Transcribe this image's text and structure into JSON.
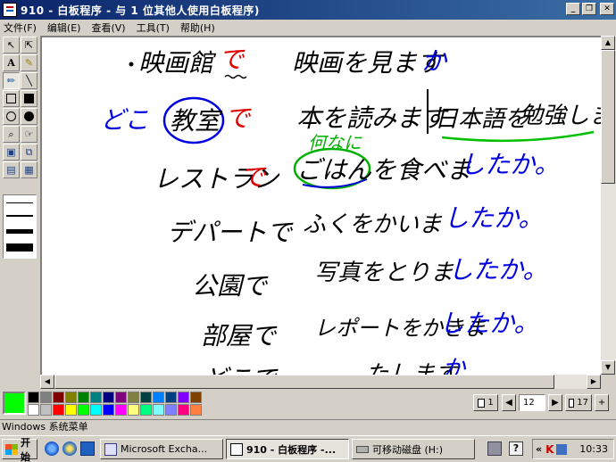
{
  "window": {
    "title": "910 - 白板程序 - 与 1 位其他人使用白板程序)",
    "controls": [
      "minimize",
      "restore",
      "close"
    ]
  },
  "menu": [
    "文件(F)",
    "编辑(E)",
    "查看(V)",
    "工具(T)",
    "帮助(H)"
  ],
  "tools": [
    {
      "name": "select-arrow-icon",
      "glyph": "↖"
    },
    {
      "name": "area-select-icon",
      "glyph": "⇱"
    },
    {
      "name": "text-tool-icon",
      "glyph": "A"
    },
    {
      "name": "highlighter-icon",
      "glyph": "✎"
    },
    {
      "name": "pen-icon",
      "glyph": "✏"
    },
    {
      "name": "line-icon",
      "glyph": "╲"
    },
    {
      "name": "rectangle-outline-icon",
      "glyph": ""
    },
    {
      "name": "rectangle-filled-icon",
      "glyph": ""
    },
    {
      "name": "ellipse-outline-icon",
      "glyph": ""
    },
    {
      "name": "ellipse-filled-icon",
      "glyph": ""
    },
    {
      "name": "zoom-icon",
      "glyph": "⌕"
    },
    {
      "name": "remote-pointer-icon",
      "glyph": "☞"
    },
    {
      "name": "lock-contents-icon",
      "glyph": "▣"
    },
    {
      "name": "sync-icon",
      "glyph": "⧉"
    },
    {
      "name": "select-window-icon",
      "glyph": "▤"
    },
    {
      "name": "select-area-icon",
      "glyph": "▦"
    }
  ],
  "handwriting": {
    "lines": [
      {
        "parts": [
          {
            "text": "映画館",
            "color": "black"
          },
          {
            "text": "で",
            "color": "red"
          },
          {
            "text": "映画を見ます",
            "color": "black"
          },
          {
            "text": "か",
            "color": "blue"
          }
        ]
      },
      {
        "parts": [
          {
            "text": "どこ",
            "color": "blue"
          },
          {
            "text": "教室",
            "color": "black"
          },
          {
            "text": "で",
            "color": "red"
          },
          {
            "text": "本を読みます",
            "color": "black"
          },
          {
            "text": "日本語を",
            "color": "black"
          },
          {
            "text": "勉強します",
            "color": "black"
          }
        ]
      },
      {
        "parts": [
          {
            "text": "何なに",
            "color": "green"
          }
        ]
      },
      {
        "parts": [
          {
            "text": "レストラン",
            "color": "black"
          },
          {
            "text": "で",
            "color": "red"
          },
          {
            "text": "ごはんを食べま",
            "color": "black"
          },
          {
            "text": "したか。",
            "color": "blue"
          }
        ]
      },
      {
        "parts": [
          {
            "text": "デパートで",
            "color": "black"
          },
          {
            "text": "ふくをかいま",
            "color": "black"
          },
          {
            "text": "したか。",
            "color": "blue"
          }
        ]
      },
      {
        "parts": [
          {
            "text": "公園で",
            "color": "black"
          },
          {
            "text": "写真をとりま",
            "color": "black"
          },
          {
            "text": "したか。",
            "color": "blue"
          }
        ]
      },
      {
        "parts": [
          {
            "text": "部屋で",
            "color": "black"
          },
          {
            "text": "レポートをかきま",
            "color": "black"
          },
          {
            "text": "したか。",
            "color": "blue"
          }
        ]
      },
      {
        "parts": [
          {
            "text": "どこで",
            "color": "black"
          },
          {
            "text": "……たします",
            "color": "black"
          },
          {
            "text": "か",
            "color": "blue"
          }
        ]
      }
    ]
  },
  "colors": {
    "current": "#00ff00",
    "palette": [
      "#000000",
      "#808080",
      "#800000",
      "#808000",
      "#008000",
      "#008080",
      "#000080",
      "#800080",
      "#808040",
      "#004040",
      "#0080ff",
      "#004080",
      "#8000ff",
      "#804000",
      "#ffffff",
      "#c0c0c0",
      "#ff0000",
      "#ffff00",
      "#00ff00",
      "#00ffff",
      "#0000ff",
      "#ff00ff",
      "#ffff80",
      "#00ff80",
      "#80ffff",
      "#8080ff",
      "#ff0080",
      "#ff8040"
    ]
  },
  "pages": {
    "first_label": "1",
    "current": "12",
    "last_label": "17"
  },
  "statusbar": {
    "text": "Windows 系统菜单"
  },
  "taskbar": {
    "start_label": "开始",
    "buttons": [
      {
        "label": "Microsoft Excha...",
        "active": false
      },
      {
        "label": "910 - 白板程序 -...",
        "active": true
      },
      {
        "label": "可移动磁盘 (H:)",
        "active": false
      }
    ],
    "clock": "10:33"
  }
}
